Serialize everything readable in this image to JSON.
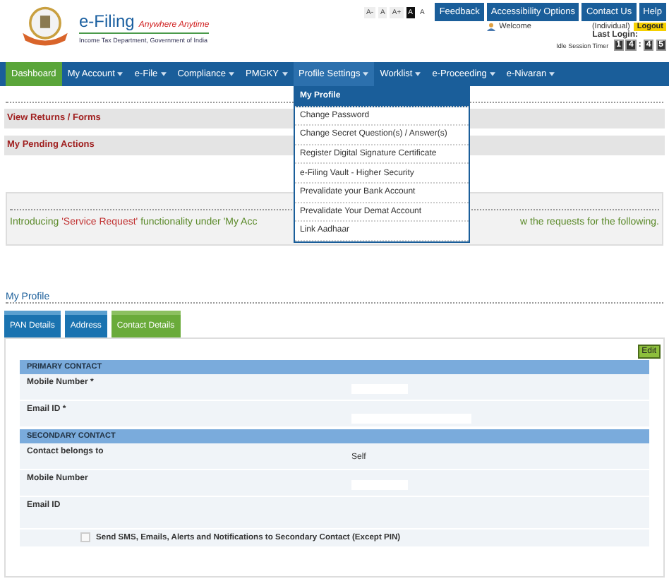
{
  "header": {
    "title": "e-Filing",
    "tagline": "Anywhere Anytime",
    "subtitle": "Income Tax Department, Government of India",
    "font_buttons": [
      {
        "label": "A-",
        "kind": "plain"
      },
      {
        "label": "A",
        "kind": "plain"
      },
      {
        "label": "A+",
        "kind": "plain"
      },
      {
        "label": "A",
        "kind": "dark"
      },
      {
        "label": "A",
        "kind": "light"
      }
    ],
    "top_buttons": [
      "Feedback",
      "Accessibility Options",
      "Contact Us",
      "Help"
    ],
    "welcome": "Welcome",
    "user_type": "(Individual)",
    "logout": "Logout",
    "last_login": "Last Login:",
    "timer_label": "Idle Session Timer",
    "timer_digits": [
      "1",
      "4",
      ":",
      "4",
      "5"
    ]
  },
  "nav": [
    {
      "label": "Dashboard",
      "selected": true,
      "expanded": false,
      "has_menu": false
    },
    {
      "label": "My Account",
      "selected": false,
      "expanded": false,
      "has_menu": true
    },
    {
      "label": "e-File",
      "selected": false,
      "expanded": false,
      "has_menu": true
    },
    {
      "label": "Compliance",
      "selected": false,
      "expanded": false,
      "has_menu": true
    },
    {
      "label": "PMGKY",
      "selected": false,
      "expanded": false,
      "has_menu": true
    },
    {
      "label": "Profile Settings",
      "selected": false,
      "expanded": true,
      "has_menu": true
    },
    {
      "label": "Worklist",
      "selected": false,
      "expanded": false,
      "has_menu": true
    },
    {
      "label": "e-Proceeding",
      "selected": false,
      "expanded": false,
      "has_menu": true
    },
    {
      "label": "e-Nivaran",
      "selected": false,
      "expanded": false,
      "has_menu": true
    }
  ],
  "dropdown": [
    {
      "label": "My Profile",
      "selected": true
    },
    {
      "label": "Change Password",
      "selected": false
    },
    {
      "label": "Change Secret Question(s) / Answer(s)",
      "selected": false
    },
    {
      "label": "Register Digital Signature Certificate",
      "selected": false
    },
    {
      "label": "e-Filing Vault - Higher Security",
      "selected": false
    },
    {
      "label": "Prevalidate your Bank Account",
      "selected": false
    },
    {
      "label": "Prevalidate Your Demat Account",
      "selected": false
    },
    {
      "label": "Link Aadhaar",
      "selected": false
    }
  ],
  "sections": [
    "View Returns / Forms",
    "My Pending Actions"
  ],
  "notice": {
    "left": [
      {
        "text": "Introducing ",
        "kind": "plain"
      },
      {
        "text": "'Service Request'",
        "kind": "highlight"
      },
      {
        "text": " functionality under 'My Acc",
        "kind": "plain"
      }
    ],
    "right": "w the requests for the following."
  },
  "profile": {
    "title": "My Profile",
    "tabs": [
      {
        "label": "PAN Details",
        "selected": false
      },
      {
        "label": "Address",
        "selected": false
      },
      {
        "label": "Contact Details",
        "selected": true
      }
    ],
    "edit": "Edit",
    "groups": [
      {
        "heading": "PRIMARY CONTACT",
        "rows": [
          {
            "label": "Mobile Number *",
            "kind": "short_field"
          },
          {
            "label": "Email ID *",
            "kind": "long_field"
          }
        ]
      },
      {
        "heading": "SECONDARY CONTACT",
        "rows": [
          {
            "label": "Contact belongs to",
            "kind": "text",
            "value": "Self"
          },
          {
            "label": "Mobile Number",
            "kind": "short_field"
          },
          {
            "label": "Email ID",
            "kind": "empty"
          }
        ]
      }
    ],
    "consent": {
      "label": "Send SMS, Emails, Alerts and Notifications to Secondary Contact (Except PIN)",
      "checked": false
    }
  }
}
